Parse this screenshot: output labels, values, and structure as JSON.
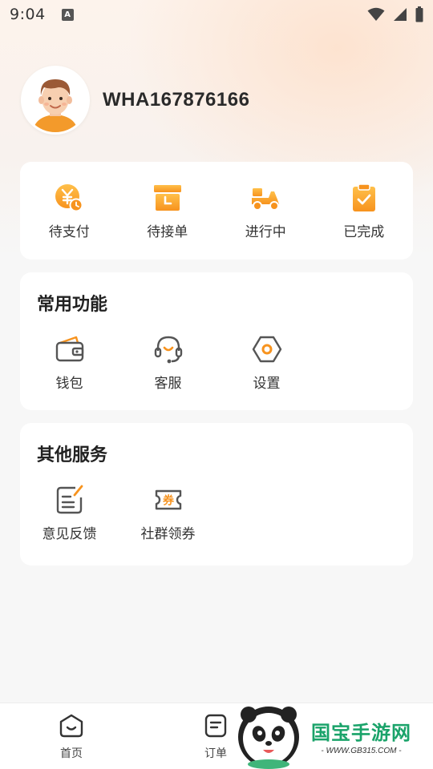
{
  "status_bar": {
    "time": "9:04",
    "notification_badge": "A"
  },
  "profile": {
    "username": "WHA167876166"
  },
  "orders": {
    "items": [
      {
        "label": "待支付",
        "icon": "yuan-clock-icon"
      },
      {
        "label": "待接单",
        "icon": "archive-box-icon"
      },
      {
        "label": "进行中",
        "icon": "delivery-scooter-icon"
      },
      {
        "label": "已完成",
        "icon": "clipboard-check-icon"
      }
    ]
  },
  "common_functions": {
    "title": "常用功能",
    "items": [
      {
        "label": "钱包",
        "icon": "wallet-icon"
      },
      {
        "label": "客服",
        "icon": "headset-icon"
      },
      {
        "label": "设置",
        "icon": "settings-hexagon-icon"
      }
    ]
  },
  "other_services": {
    "title": "其他服务",
    "items": [
      {
        "label": "意见反馈",
        "icon": "feedback-note-icon"
      },
      {
        "label": "社群领券",
        "icon": "coupon-icon",
        "icon_text": "券"
      }
    ]
  },
  "tabbar": {
    "tabs": [
      {
        "label": "首页",
        "icon": "home-smile-icon"
      },
      {
        "label": "订单",
        "icon": "order-list-icon"
      }
    ]
  },
  "watermark": {
    "title": "国宝手游网",
    "subtitle": "- WWW.GB315.COM -"
  },
  "colors": {
    "accent": "#f7931e",
    "accent_light": "#ffc04a",
    "icon_gray": "#555555",
    "watermark_green": "#1aa36a"
  }
}
